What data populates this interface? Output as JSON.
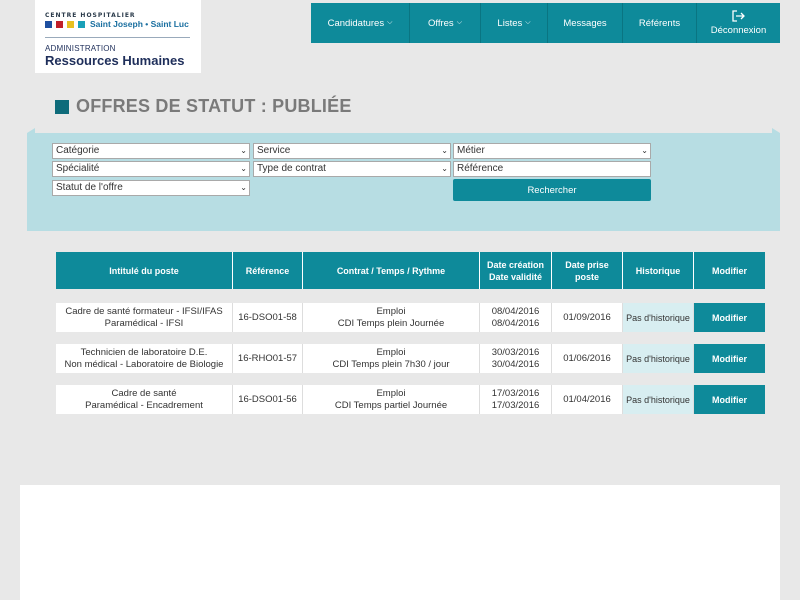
{
  "logo": {
    "line1": "CENTRE HOSPITALIER",
    "line2": "Saint Joseph • Saint Luc",
    "line3": "ADMINISTRATION",
    "line4": "Ressources Humaines",
    "square_colors": [
      "#1e4fa0",
      "#c0202a",
      "#e8c020",
      "#1aa0b8"
    ]
  },
  "nav": {
    "candidatures": "Candidatures",
    "offres": "Offres",
    "listes": "Listes",
    "messages": "Messages",
    "referents": "Référents",
    "deconnexion": "Déconnexion"
  },
  "page": {
    "title": "OFFRES DE STATUT : PUBLIÉE"
  },
  "filters": {
    "categorie": "Catégorie",
    "service": "Service",
    "metier": "Métier",
    "specialite": "Spécialité",
    "type_contrat": "Type de contrat",
    "reference_placeholder": "Référence",
    "statut": "Statut de l'offre",
    "search_button": "Rechercher"
  },
  "table": {
    "headers": {
      "intitule": "Intitulé du poste",
      "reference": "Référence",
      "contrat": "Contrat / Temps / Rythme",
      "date_creation": "Date création",
      "date_validite": "Date validité",
      "date_prise": "Date prise poste",
      "historique": "Historique",
      "modifier": "Modifier"
    },
    "rows": [
      {
        "intitule1": "Cadre de santé formateur - IFSI/IFAS",
        "intitule2": "Paramédical - IFSI",
        "reference": "16-DSO01-58",
        "contrat1": "Emploi",
        "contrat2": "CDI Temps plein Journée",
        "creation": "08/04/2016",
        "validite": "08/04/2016",
        "prise": "01/09/2016",
        "historique": "Pas d'historique",
        "modifier": "Modifier"
      },
      {
        "intitule1": "Technicien de laboratoire D.E.",
        "intitule2": "Non médical - Laboratoire de Biologie",
        "reference": "16-RHO01-57",
        "contrat1": "Emploi",
        "contrat2": "CDI Temps plein 7h30 / jour",
        "creation": "30/03/2016",
        "validite": "30/04/2016",
        "prise": "01/06/2016",
        "historique": "Pas d'historique",
        "modifier": "Modifier"
      },
      {
        "intitule1": "Cadre de santé",
        "intitule2": "Paramédical - Encadrement",
        "reference": "16-DSO01-56",
        "contrat1": "Emploi",
        "contrat2": "CDI Temps partiel Journée",
        "creation": "17/03/2016",
        "validite": "17/03/2016",
        "prise": "01/04/2016",
        "historique": "Pas d'historique",
        "modifier": "Modifier"
      }
    ]
  },
  "colors": {
    "accent": "#0e8a9a",
    "filter_band": "#b7dde3",
    "title_gray": "#7a7a7a"
  }
}
